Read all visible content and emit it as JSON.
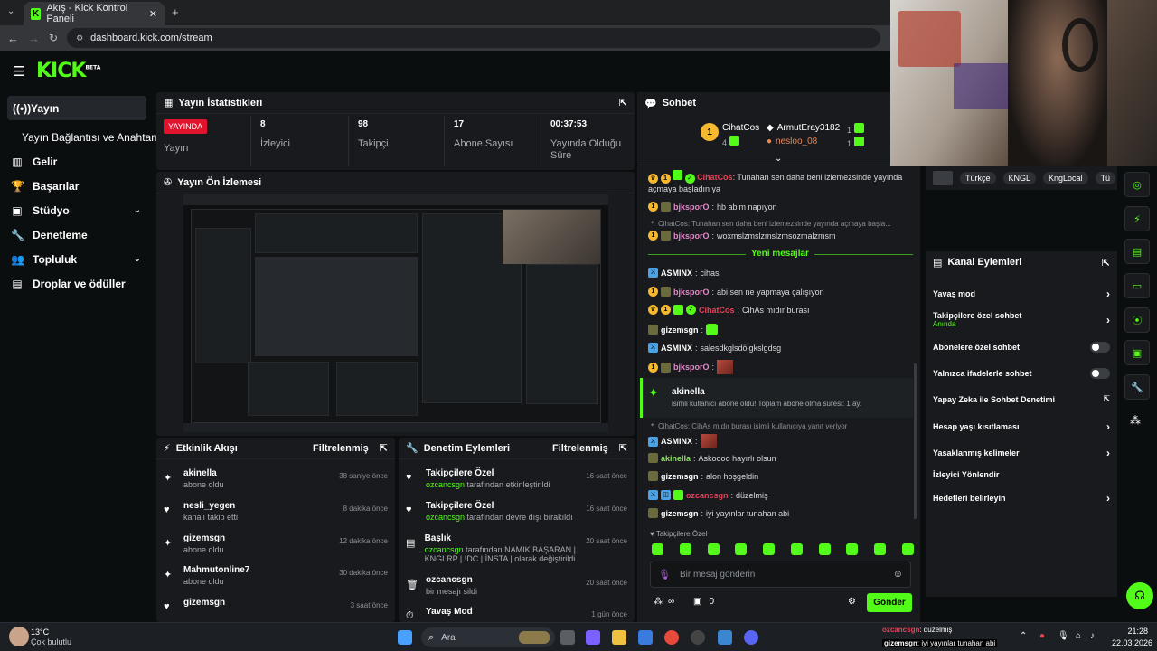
{
  "browser": {
    "tab_title": "Akış - Kick Kontrol Paneli",
    "url": "dashboard.kick.com/stream"
  },
  "app": {
    "logo": "KICK",
    "logo_badge": "BETA"
  },
  "sidebar": {
    "items": [
      {
        "label": "Yayın",
        "icon": "broadcast-icon"
      },
      {
        "label": "Yayın Bağlantısı ve Anahtarı"
      },
      {
        "label": "Gelir",
        "icon": "chart-icon"
      },
      {
        "label": "Başarılar",
        "icon": "trophy-icon"
      },
      {
        "label": "Stüdyo",
        "icon": "studio-icon"
      },
      {
        "label": "Denetleme",
        "icon": "wrench-icon"
      },
      {
        "label": "Topluluk",
        "icon": "people-icon"
      },
      {
        "label": "Droplar ve ödüller",
        "icon": "gift-icon"
      }
    ]
  },
  "stats": {
    "title": "Yayın İstatistikleri",
    "live_badge": "YAYINDA",
    "live_label": "Yayın",
    "viewers_value": "8",
    "viewers_label": "İzleyici",
    "followers_value": "98",
    "followers_label": "Takipçi",
    "subs_value": "17",
    "subs_label": "Abone Sayısı",
    "uptime_value": "00:37:53",
    "uptime_label": "Yayında Olduğu Süre"
  },
  "preview": {
    "title": "Yayın Ön İzlemesi"
  },
  "activity": {
    "title": "Etkinlik Akışı",
    "filter": "Filtrelenmiş",
    "items": [
      {
        "name": "akinella",
        "sub": "abone oldu",
        "time": "38 saniye önce"
      },
      {
        "name": "nesli_yegen",
        "sub": "kanalı takip etti",
        "time": "8 dakika önce"
      },
      {
        "name": "gizemsgn",
        "sub": "abone oldu",
        "time": "12 dakika önce"
      },
      {
        "name": "Mahmutonline7",
        "sub": "abone oldu",
        "time": "30 dakika önce"
      },
      {
        "name": "gizemsgn",
        "sub": "",
        "time": "3 saat önce"
      }
    ]
  },
  "moderation": {
    "title": "Denetim Eylemleri",
    "filter": "Filtrelenmiş",
    "items": [
      {
        "name": "Takipçilere Özel",
        "user": "ozcancsgn",
        "sub": " tarafından etkinleştirildi",
        "time": "16 saat önce"
      },
      {
        "name": "Takipçilere Özel",
        "user": "ozcancsgn",
        "sub": " tarafından devre dışı bırakıldı",
        "time": "16 saat önce"
      },
      {
        "name": "Başlık",
        "user": "ozcancsgn",
        "sub": " tarafından NAMIK BAŞARAN | KNGLRP | !DC | İNSTA | olarak değiştirildi",
        "time": "20 saat önce"
      },
      {
        "name": "ozcancsgn",
        "user": "",
        "sub": "bir mesajı sildi",
        "time": "20 saat önce"
      },
      {
        "name": "Yavaş Mod",
        "user": "",
        "sub": "",
        "time": "1 gün önce"
      }
    ]
  },
  "chat": {
    "title": "Sohbet",
    "top1_name": "CihatCos",
    "top1_count": "4",
    "top2_name": "ArmutEray3182",
    "top2_count": "1",
    "top3_name": "nesloo_08",
    "top3_count": "1",
    "msg1_user": "CihatCos",
    "msg1_text": "Tunahan sen daha beni izlemezsinde yayında açmaya başladın ya",
    "msg2_user": "bjksporO",
    "msg2_text": "hb abim napıyon",
    "reply1": "CihatCos: Tunahan sen daha beni izlemezsinde yayında açmaya başla...",
    "msg3_user": "bjksporO",
    "msg3_text": "woxmslzmslzmslzmsozmalzmsm",
    "new_messages": "Yeni mesajlar",
    "msg4_user": "ASMINX",
    "msg4_text": "cihas",
    "msg5_user": "bjksporO",
    "msg5_text": "abi sen ne yapmaya çalışıyon",
    "msg6_user": "CihatCos",
    "msg6_text": "CihAs mıdır burası",
    "msg7_user": "gizemsgn",
    "msg8_user": "ASMINX",
    "msg8_text": "salesdkglsdölgkslgdsg",
    "msg9_user": "bjksporO",
    "sub_user": "akinella",
    "sub_text": "isimli kullanıcı abone oldu! Toplam abone olma süresi: 1 ay.",
    "reply2": "CihatCos: CihAs mıdır burası isimli kullanıcıya yanıt veriyor",
    "msg10_user": "ASMINX",
    "msg11_user": "akinella",
    "msg11_text": "Askoooo hayırlı olsun",
    "msg12_user": "gizemsgn",
    "msg12_text": "alon hoşgeldin",
    "msg13_user": "ozcancsgn",
    "msg13_text": "düzelmiş",
    "msg14_user": "gizemsgn",
    "msg14_text": "iyi yayınlar tunahan abi",
    "followers_only": "Takipçilere Özel",
    "input_placeholder": "Bir mesaj gönderin",
    "points": "∞",
    "gift_count": "0",
    "send_label": "Gönder"
  },
  "tags": [
    "Türkçe",
    "KNGL",
    "KngLocal",
    "Tü"
  ],
  "channel_actions": {
    "title": "Kanal Eylemleri",
    "items": [
      {
        "label": "Yavaş mod",
        "kind": "chevron"
      },
      {
        "label": "Takipçilere özel sohbet",
        "sub": "Anında",
        "kind": "chevron"
      },
      {
        "label": "Abonelere özel sohbet",
        "kind": "toggle",
        "on": false
      },
      {
        "label": "Yalnızca ifadelerle sohbet",
        "kind": "toggle",
        "on": false
      },
      {
        "label": "Yapay Zeka ile Sohbet Denetimi",
        "kind": "external"
      },
      {
        "label": "Hesap yaşı kısıtlaması",
        "kind": "chevron"
      },
      {
        "label": "Yasaklanmış kelimeler",
        "kind": "chevron"
      },
      {
        "label": "İzleyici Yönlendir",
        "kind": "none"
      },
      {
        "label": "Hedefleri belirleyin",
        "kind": "chevron"
      }
    ]
  },
  "taskbar": {
    "weather_temp": "13°C",
    "weather_desc": "Çok bulutlu",
    "search": "Ara",
    "notif_user1": "ozcancsgn",
    "notif_text1": ": düzelmiş",
    "notif_user2": "gizemsgn",
    "notif_text2": ": iyi yayınlar tunahan abi",
    "time": "21:28",
    "date": "22.03.2026"
  },
  "colors": {
    "accent": "#53fc18",
    "live": "#e2142d",
    "panel": "#181a1d",
    "bg": "#0b0e0f"
  }
}
